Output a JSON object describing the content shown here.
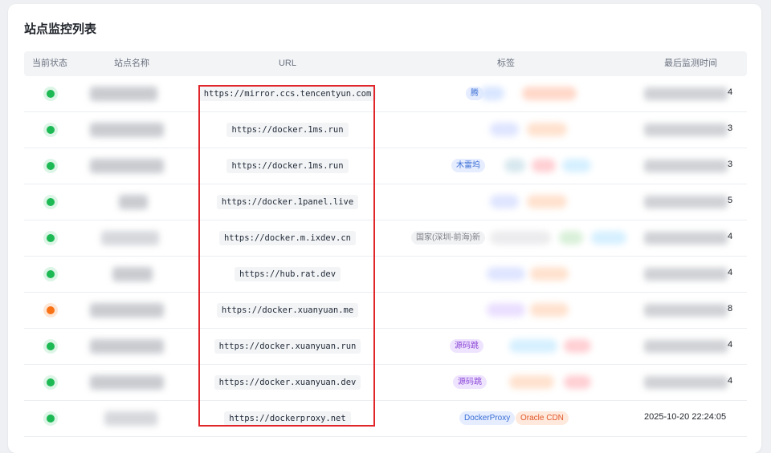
{
  "page": {
    "title": "站点监控列表"
  },
  "table": {
    "headers": {
      "status": "当前状态",
      "name": "站点名称",
      "url": "URL",
      "tags": "标签",
      "last_check": "最后监测时间"
    },
    "rows": [
      {
        "status": "ok",
        "url": "https://mirror.ccs.tencentyun.com",
        "tag_visible": "腾",
        "time_tail": "4"
      },
      {
        "status": "ok",
        "url": "https://docker.1ms.run",
        "tag_visible": "",
        "time_tail": "3"
      },
      {
        "status": "ok",
        "url": "https://docker.1ms.run",
        "tag_visible": "木雷坞",
        "time_tail": "3"
      },
      {
        "status": "ok",
        "url": "https://docker.1panel.live",
        "tag_visible": "",
        "time_tail": "5"
      },
      {
        "status": "ok",
        "url": "https://docker.m.ixdev.cn",
        "tag_visible": "国家(深圳-前海)新",
        "time_tail": "4"
      },
      {
        "status": "ok",
        "url": "https://hub.rat.dev",
        "tag_visible": "",
        "time_tail": "4"
      },
      {
        "status": "warn",
        "url": "https://docker.xuanyuan.me",
        "tag_visible": "",
        "time_tail": "8"
      },
      {
        "status": "ok",
        "url": "https://docker.xuanyuan.run",
        "tag_visible": "源码跳",
        "time_tail": "4"
      },
      {
        "status": "ok",
        "url": "https://docker.xuanyuan.dev",
        "tag_visible": "源码跳",
        "time_tail": "4"
      },
      {
        "status": "ok",
        "url": "https://dockerproxy.net",
        "tag_1": "DockerProxy",
        "tag_2": "Oracle CDN",
        "time_full": "2025-10-20 22:24:05"
      }
    ]
  },
  "colors": {
    "status_ok": "#1db954",
    "status_warn": "#f97316",
    "highlight_box": "#e0262b"
  }
}
